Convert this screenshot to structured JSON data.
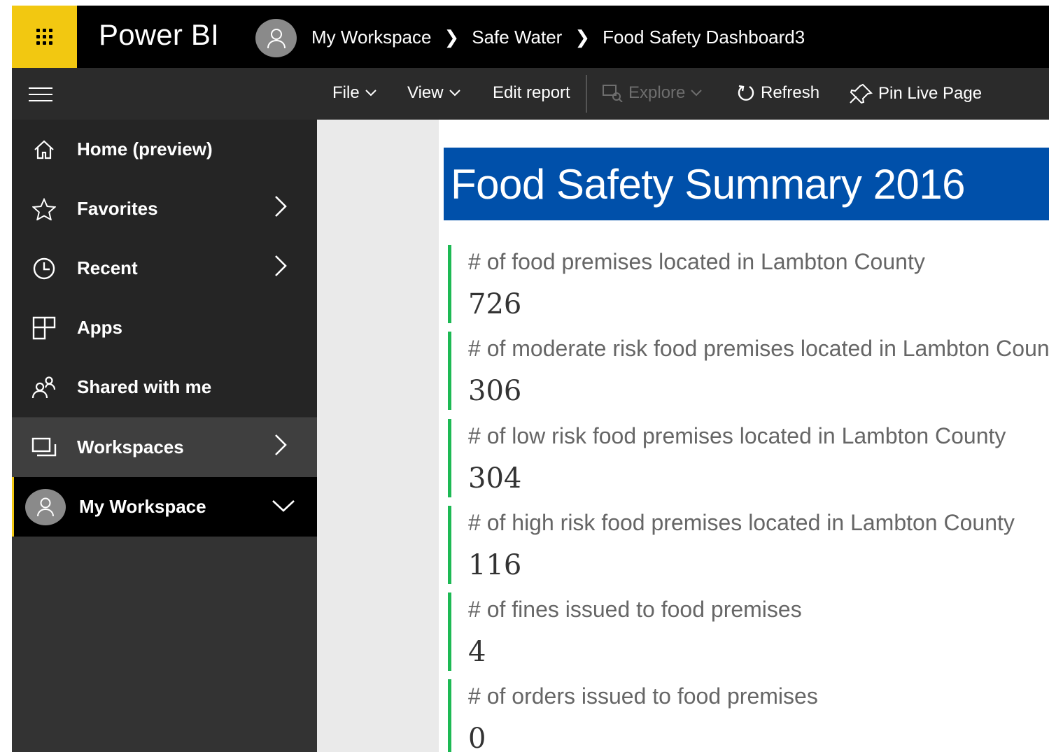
{
  "app": {
    "name": "Power BI"
  },
  "breadcrumb": [
    "My Workspace",
    "Safe Water",
    "Food Safety Dashboard3"
  ],
  "commandbar": {
    "file": "File",
    "view": "View",
    "edit_report": "Edit report",
    "explore": "Explore",
    "refresh": "Refresh",
    "pin_live_page": "Pin Live Page"
  },
  "sidebar": {
    "items": [
      {
        "label": "Home (preview)",
        "icon": "home-icon"
      },
      {
        "label": "Favorites",
        "icon": "star-icon"
      },
      {
        "label": "Recent",
        "icon": "clock-icon"
      },
      {
        "label": "Apps",
        "icon": "apps-icon"
      },
      {
        "label": "Shared with me",
        "icon": "shared-icon"
      },
      {
        "label": "Workspaces",
        "icon": "workspaces-icon"
      },
      {
        "label": "My Workspace",
        "icon": "avatar"
      }
    ]
  },
  "report": {
    "title": "Food Safety Summary 2016",
    "cards": [
      {
        "label": "# of food premises located in Lambton County",
        "value": "726"
      },
      {
        "label": "# of moderate risk food premises located in Lambton County",
        "value": "306"
      },
      {
        "label": "# of low risk food premises located in Lambton County",
        "value": "304"
      },
      {
        "label": "# of high risk food premises located in Lambton County",
        "value": "116"
      },
      {
        "label": "# of fines issued to food premises",
        "value": "4"
      },
      {
        "label": "# of orders issued to food premises",
        "value": "0"
      }
    ]
  },
  "colors": {
    "brand_yellow": "#f2c811",
    "title_blue": "#0050aa",
    "card_accent": "#1db954",
    "nav_bg": "#333333"
  }
}
